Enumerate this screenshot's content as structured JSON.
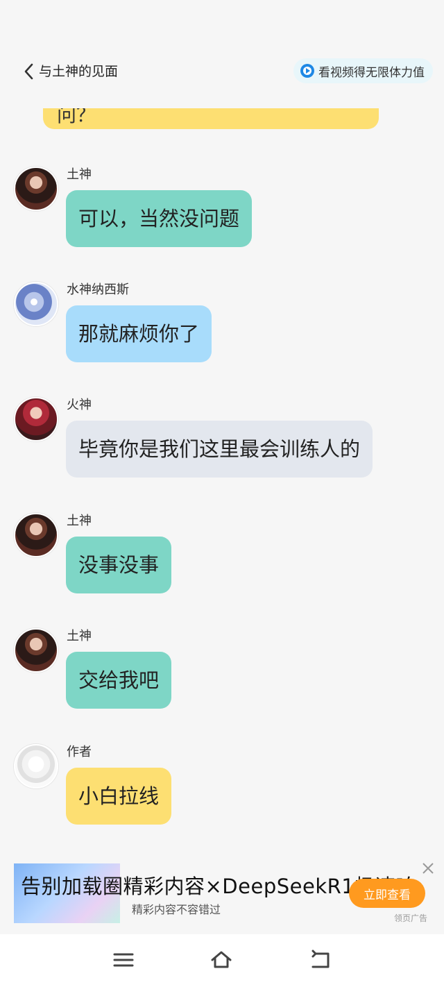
{
  "header": {
    "chapter_title": "与土神的见面",
    "video_reward_label": "看视频得无限体力值",
    "icons": [
      "back-chevron-icon",
      "play-circle-icon"
    ]
  },
  "partial_message": {
    "text": "问？"
  },
  "messages": [
    {
      "sender": "土神",
      "text": "可以，当然没问题",
      "avatar": "earth-god-avatar",
      "bubble_color": "#7ed6c6"
    },
    {
      "sender": "水神纳西斯",
      "text": "那就麻烦你了",
      "avatar": "water-god-avatar",
      "bubble_color": "#a8dcfb"
    },
    {
      "sender": "火神",
      "text": "毕竟你是我们这里最会训练人的",
      "avatar": "fire-god-avatar",
      "bubble_color": "#e3e7ee"
    },
    {
      "sender": "土神",
      "text": "没事没事",
      "avatar": "earth-god-avatar",
      "bubble_color": "#7ed6c6"
    },
    {
      "sender": "土神",
      "text": "交给我吧",
      "avatar": "earth-god-avatar",
      "bubble_color": "#7ed6c6"
    },
    {
      "sender": "作者",
      "text": "小白拉线",
      "avatar": "author-avatar",
      "bubble_color": "#fddf72"
    }
  ],
  "ad": {
    "headline": "告别加载圈精彩内容×DeepSeekR1极速响",
    "subtitle": "精彩内容不容错过",
    "button_label": "立即查看",
    "tag": "领页广告",
    "accent_color": "#ff9a1f"
  },
  "navigation": {
    "icons": [
      "menu-icon",
      "home-icon",
      "back-icon"
    ]
  }
}
